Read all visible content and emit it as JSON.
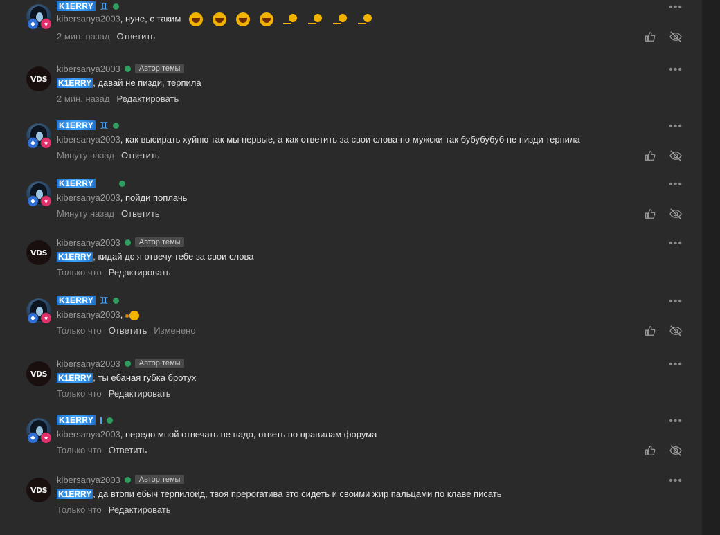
{
  "comments": [
    {
      "author": "K1ERRY",
      "author_kind": "k",
      "zodiac": "♊",
      "author_tag": "",
      "mention": "kibersanya2003",
      "text": ", нуне, с таким",
      "emojis": "laugh",
      "time": "2 мин. назад",
      "actions": [
        "Ответить"
      ],
      "edited": "",
      "owned": false
    },
    {
      "author": "kibersanya2003",
      "author_kind": "kib",
      "zodiac": "",
      "author_tag": "Автор темы",
      "mention": "K1ERRY",
      "text": ", давай не пизди, терпила",
      "emojis": "",
      "time": "2 мин. назад",
      "actions": [
        "Редактировать"
      ],
      "edited": "",
      "owned": true
    },
    {
      "author": "K1ERRY",
      "author_kind": "k",
      "zodiac": "♊",
      "author_tag": "",
      "mention": "kibersanya2003",
      "text": ", как высирать хуйню так мы первые, а как ответить за свои слова по мужски так бубубубуб не пизди терпила",
      "emojis": "",
      "time": "Минуту назад",
      "actions": [
        "Ответить"
      ],
      "edited": "",
      "owned": false
    },
    {
      "author": "K1ERRY",
      "author_kind": "k",
      "zodiac": "",
      "author_tag": "",
      "mention": "kibersanya2003",
      "text": ", пойди поплачь",
      "emojis": "",
      "time": "Минуту назад",
      "actions": [
        "Ответить"
      ],
      "edited": "",
      "owned": false
    },
    {
      "author": "kibersanya2003",
      "author_kind": "kib",
      "zodiac": "",
      "author_tag": "Автор темы",
      "mention": "K1ERRY",
      "text": ", кидай дс я отвечу тебе за свои слова",
      "emojis": "",
      "time": "Только что",
      "actions": [
        "Редактировать"
      ],
      "edited": "",
      "owned": true
    },
    {
      "author": "K1ERRY",
      "author_kind": "k",
      "zodiac": "♊",
      "author_tag": "",
      "mention": "kibersanya2003",
      "text": ",",
      "emojis": "small",
      "time": "Только что",
      "actions": [
        "Ответить"
      ],
      "edited": "Изменено",
      "owned": false
    },
    {
      "author": "kibersanya2003",
      "author_kind": "kib",
      "zodiac": "",
      "author_tag": "Автор темы",
      "mention": "K1ERRY",
      "text": ", ты ебаная губка бротух",
      "emojis": "",
      "time": "Только что",
      "actions": [
        "Редактировать"
      ],
      "edited": "",
      "owned": true
    },
    {
      "author": "K1ERRY",
      "author_kind": "k",
      "zodiac": "I",
      "author_tag": "",
      "mention": "kibersanya2003",
      "text": ", передо мной отвечать не надо, ответь по правилам форума",
      "emojis": "",
      "time": "Только что",
      "actions": [
        "Ответить"
      ],
      "edited": "",
      "owned": false
    },
    {
      "author": "kibersanya2003",
      "author_kind": "kib",
      "zodiac": "",
      "author_tag": "Автор темы",
      "mention": "K1ERRY",
      "text": ", да втопи ебыч терпилоид, твоя прерогатива это сидеть и своими жир пальцами по клаве писать",
      "emojis": "",
      "time": "Только что",
      "actions": [
        "Редактировать"
      ],
      "edited": "",
      "owned": true
    }
  ],
  "avatar_vds_label": "VDS",
  "icons": {
    "more": "more-dots-icon",
    "like": "thumbs-up-icon",
    "hide": "eye-off-icon",
    "eth": "ethereum-badge-icon",
    "heart": "heart-badge-icon"
  },
  "colors": {
    "background": "#2a2a2a",
    "accent_blue": "#3fa4ff",
    "online": "#2f9d5f",
    "heart_badge": "#e0316a",
    "eth_badge": "#2f6fd6"
  }
}
